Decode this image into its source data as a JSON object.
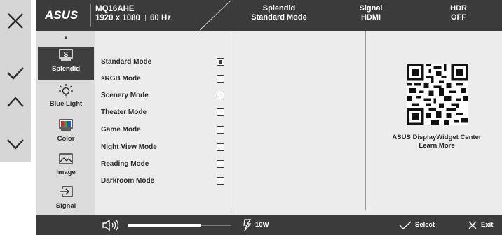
{
  "keys": [
    {
      "icon": "close-icon"
    },
    {
      "icon": "check-icon"
    },
    {
      "icon": "chevron-up-icon"
    },
    {
      "icon": "chevron-down-icon"
    }
  ],
  "header": {
    "logo_text": "ASUS",
    "model": "MQ16AHE",
    "resolution": "1920 x 1080",
    "refresh": "60 Hz",
    "status": [
      {
        "title": "Splendid",
        "value": "Standard Mode"
      },
      {
        "title": "Signal",
        "value": "HDMI"
      },
      {
        "title": "HDR",
        "value": "OFF"
      }
    ]
  },
  "sidebar": {
    "items": [
      {
        "label": "Splendid",
        "icon": "monitor-s-icon",
        "active": true
      },
      {
        "label": "Blue Light",
        "icon": "bulb-icon",
        "active": false
      },
      {
        "label": "Color",
        "icon": "color-bars-icon",
        "active": false
      },
      {
        "label": "Image",
        "icon": "picture-icon",
        "active": false
      },
      {
        "label": "Signal",
        "icon": "input-signal-icon",
        "active": false
      }
    ]
  },
  "modes": [
    {
      "label": "Standard Mode",
      "checked": true
    },
    {
      "label": "sRGB Mode",
      "checked": false
    },
    {
      "label": "Scenery Mode",
      "checked": false
    },
    {
      "label": "Theater Mode",
      "checked": false
    },
    {
      "label": "Game Mode",
      "checked": false
    },
    {
      "label": "Night View Mode",
      "checked": false
    },
    {
      "label": "Reading Mode",
      "checked": false
    },
    {
      "label": "Darkroom Mode",
      "checked": false
    }
  ],
  "qr": {
    "line1": "ASUS DisplayWidget Center",
    "line2": "Learn More"
  },
  "footer": {
    "volume_level": 0.7,
    "power_label": "10W",
    "select_label": "Select",
    "exit_label": "Exit"
  },
  "colors": {
    "header_bg": "#3b3b3b",
    "panel_bg": "#ececec",
    "sidebar_bg": "#dcdcdc",
    "active_bg": "#3f3f3f",
    "keys_bg": "#d6d6d6"
  }
}
